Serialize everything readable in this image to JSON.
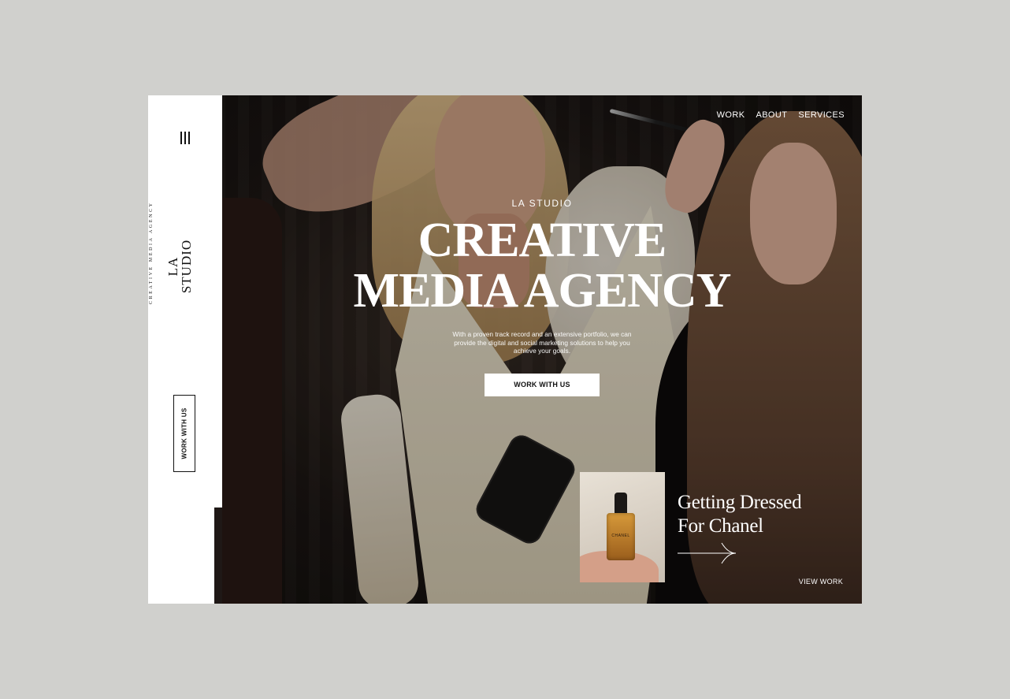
{
  "brand": {
    "name_line1": "LA",
    "name_line2": "STUDIO",
    "tagline": "CREATIVE MEDIA AGENCY"
  },
  "sidebar": {
    "menu_icon": "hamburger-menu-icon",
    "cta_label": "WORK WITH US"
  },
  "nav": {
    "items": [
      "WORK",
      "ABOUT",
      "SERVICES"
    ]
  },
  "hero": {
    "eyebrow": "LA STUDIO",
    "headline_line1": "CREATIVE",
    "headline_line2": "MEDIA AGENCY",
    "subtext": "With a proven track record and an extensive portfolio, we can provide the digital and social marketing solutions to help you achieve your goals.",
    "cta_label": "WORK WITH US"
  },
  "feature": {
    "title_line1": "Getting Dressed",
    "title_line2": "For Chanel",
    "thumbnail_label": "CHANEL",
    "arrow_icon": "arrow-right-icon",
    "link_label": "VIEW WORK"
  },
  "colors": {
    "background": "#d0d0cd",
    "sidebar": "#ffffff",
    "text_light": "#ffffff",
    "text_dark": "#111111"
  }
}
